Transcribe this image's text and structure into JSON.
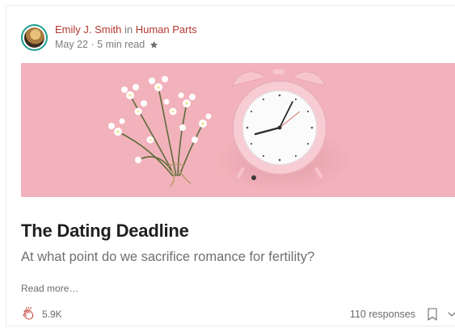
{
  "post": {
    "author_name": "Emily J. Smith",
    "in_word": "in",
    "publication": "Human Parts",
    "date": "May 22",
    "separator": "·",
    "read_time": "5 min read",
    "title": "The Dating Deadline",
    "subtitle": "At what point do we sacrifice romance for fertility?",
    "read_more": "Read more…",
    "claps": "5.9K",
    "responses": "110 responses"
  },
  "icons": {
    "avatar": "author-avatar",
    "star": "star-icon",
    "clap": "clap-icon",
    "bookmark": "bookmark-icon",
    "more": "chevron-down-icon",
    "hero_image": "alarm-clock-and-flowers-photo"
  },
  "colors": {
    "link": "#b4372f",
    "avatar_ring": "#1d9d8f",
    "hero_bg": "#f3b6bf",
    "title": "#1f1f1f",
    "muted": "#6b6b6b"
  }
}
